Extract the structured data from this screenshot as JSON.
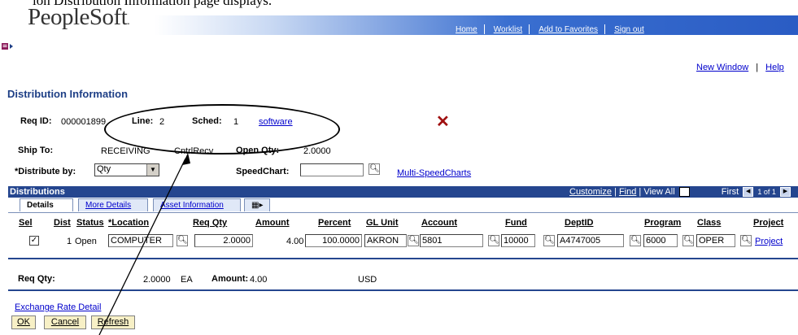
{
  "caption": "ion Distribution Information page displays.",
  "header": {
    "logo": "PeopleSoft",
    "nav": [
      "Home",
      "Worklist",
      "Add to Favorites",
      "Sign out"
    ]
  },
  "utility_links": {
    "new_window": "New Window",
    "help": "Help"
  },
  "page_title": "Distribution Information",
  "info": {
    "req_id_label": "Req ID:",
    "req_id_value": "000001899",
    "line_label": "Line:",
    "line_value": "2",
    "sched_label": "Sched:",
    "sched_value": "1",
    "item_link": "software",
    "ship_to_label": "Ship To:",
    "ship_to_value": "RECEIVING",
    "ship_to_desc": "CntrlRecv",
    "open_qty_label": "Open Qty:",
    "open_qty_value": "2.0000",
    "distribute_by_label": "*Distribute by:",
    "distribute_by_value": "Qty",
    "speedchart_label": "SpeedChart:",
    "speedchart_value": "",
    "multi_speedcharts": "Multi-SpeedCharts"
  },
  "grid": {
    "title": "Distributions",
    "controls": {
      "customize": "Customize",
      "find": "Find",
      "view_all": "View All",
      "pager": "First",
      "count": "1 of 1"
    },
    "tabs": [
      "Details",
      "More Details",
      "Asset Information"
    ],
    "columns": [
      "Sel",
      "Dist",
      "Status",
      "*Location",
      "Req Qty",
      "Amount",
      "Percent",
      "GL Unit",
      "Account",
      "Fund",
      "DeptID",
      "Program",
      "Class",
      "Project"
    ],
    "row": {
      "selected": true,
      "dist": "1",
      "status": "Open",
      "location": "COMPUTER",
      "req_qty": "2.0000",
      "amount": "4.00",
      "percent": "100.0000",
      "gl_unit": "AKRON",
      "account": "5801",
      "fund": "10000",
      "deptid": "A4747005",
      "program": "6000",
      "class": "OPER",
      "project": "Project"
    }
  },
  "totals": {
    "req_qty_label": "Req Qty:",
    "req_qty_value": "2.0000",
    "uom": "EA",
    "amount_label": "Amount:",
    "amount_value": "4.00",
    "currency": "USD"
  },
  "exchange_link": "Exchange Rate Detail",
  "buttons": {
    "ok": "OK",
    "cancel": "Cancel",
    "refresh": "Refresh"
  },
  "colors": {
    "accent": "#25468f",
    "link": "#0000cc",
    "button_bg": "#f7f0c6"
  }
}
